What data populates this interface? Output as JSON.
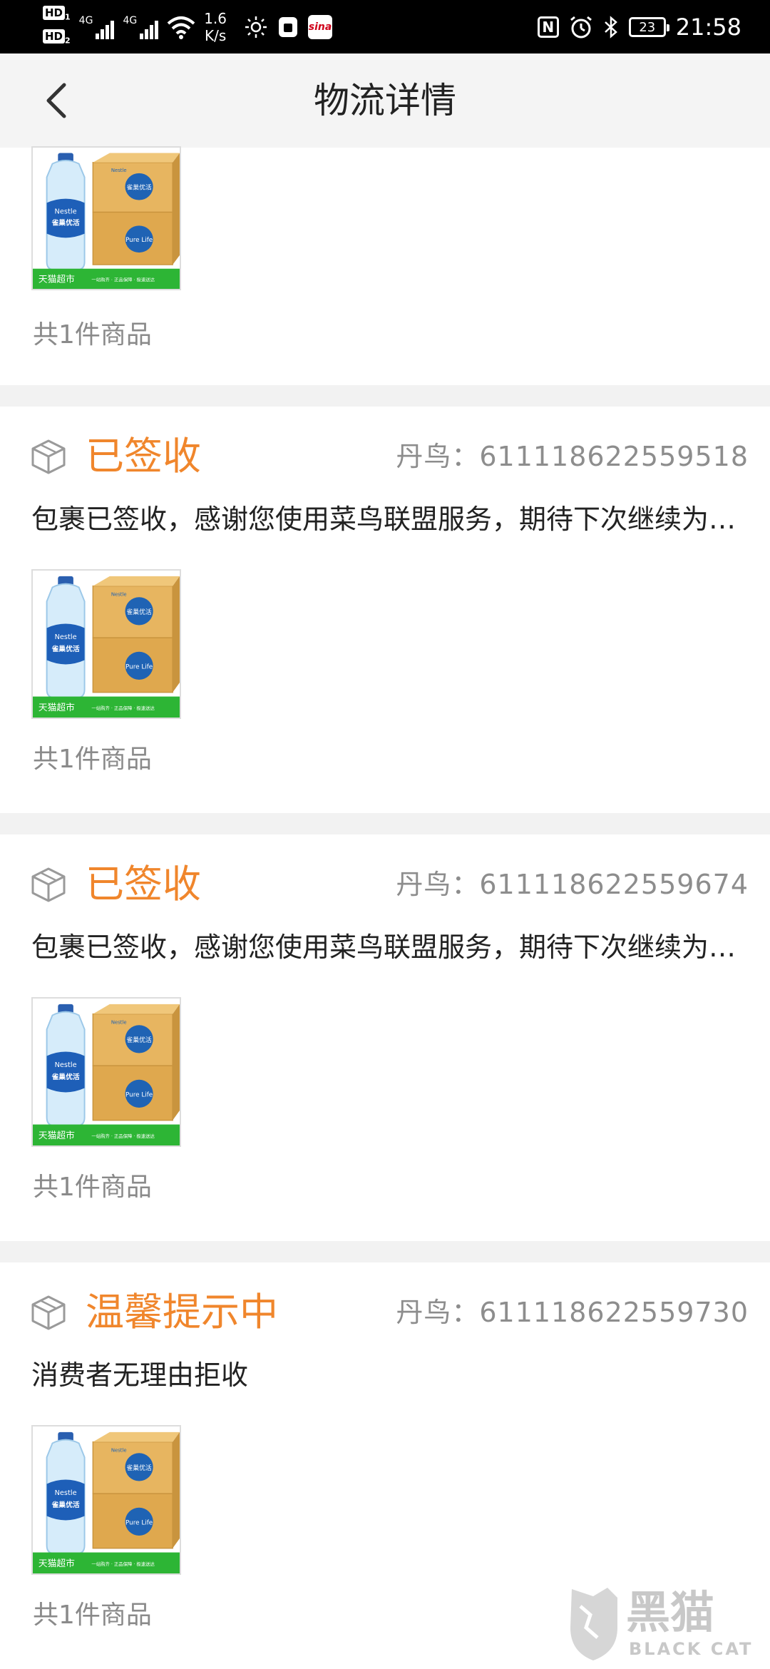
{
  "status_bar": {
    "hd1": "HD",
    "hd1_sub": "1",
    "hd2": "HD",
    "hd2_sub": "2",
    "net1": "4G",
    "net2": "4G",
    "speed_value": "1.6",
    "speed_unit": "K/s",
    "sina_label": "sina",
    "nfc_label": "N",
    "battery": "23",
    "time": "21:58"
  },
  "nav": {
    "title": "物流详情",
    "back_icon": "chevron-left-icon"
  },
  "product_image": {
    "brand": "Nestle",
    "bottle_label": "雀巢优活",
    "box_label": "雀巢优活",
    "box_sub": "Pure Life",
    "store_label": "天猫超市",
    "banner_text": "一站购齐 · 正品保障 · 极速送达",
    "store_color": "#2db535"
  },
  "packages": [
    {
      "status": "",
      "tracking": "",
      "description": "",
      "count": "共1件商品"
    },
    {
      "status": "已签收",
      "tracking": "丹鸟：611118622559518",
      "description": "包裹已签收，感谢您使用菜鸟联盟服务，期待下次继续为您服务",
      "count": "共1件商品"
    },
    {
      "status": "已签收",
      "tracking": "丹鸟：611118622559674",
      "description": "包裹已签收，感谢您使用菜鸟联盟服务，期待下次继续为您服务",
      "count": "共1件商品"
    },
    {
      "status": "温馨提示中",
      "tracking": "丹鸟：611118622559730",
      "description": "消费者无理由拒收",
      "count": "共1件商品"
    }
  ],
  "colors": {
    "accent": "#f0862c",
    "muted": "#8d8d8d",
    "divider": "#f2f2f2"
  },
  "watermark": {
    "main": "黑猫",
    "sub": "BLACK CAT"
  }
}
